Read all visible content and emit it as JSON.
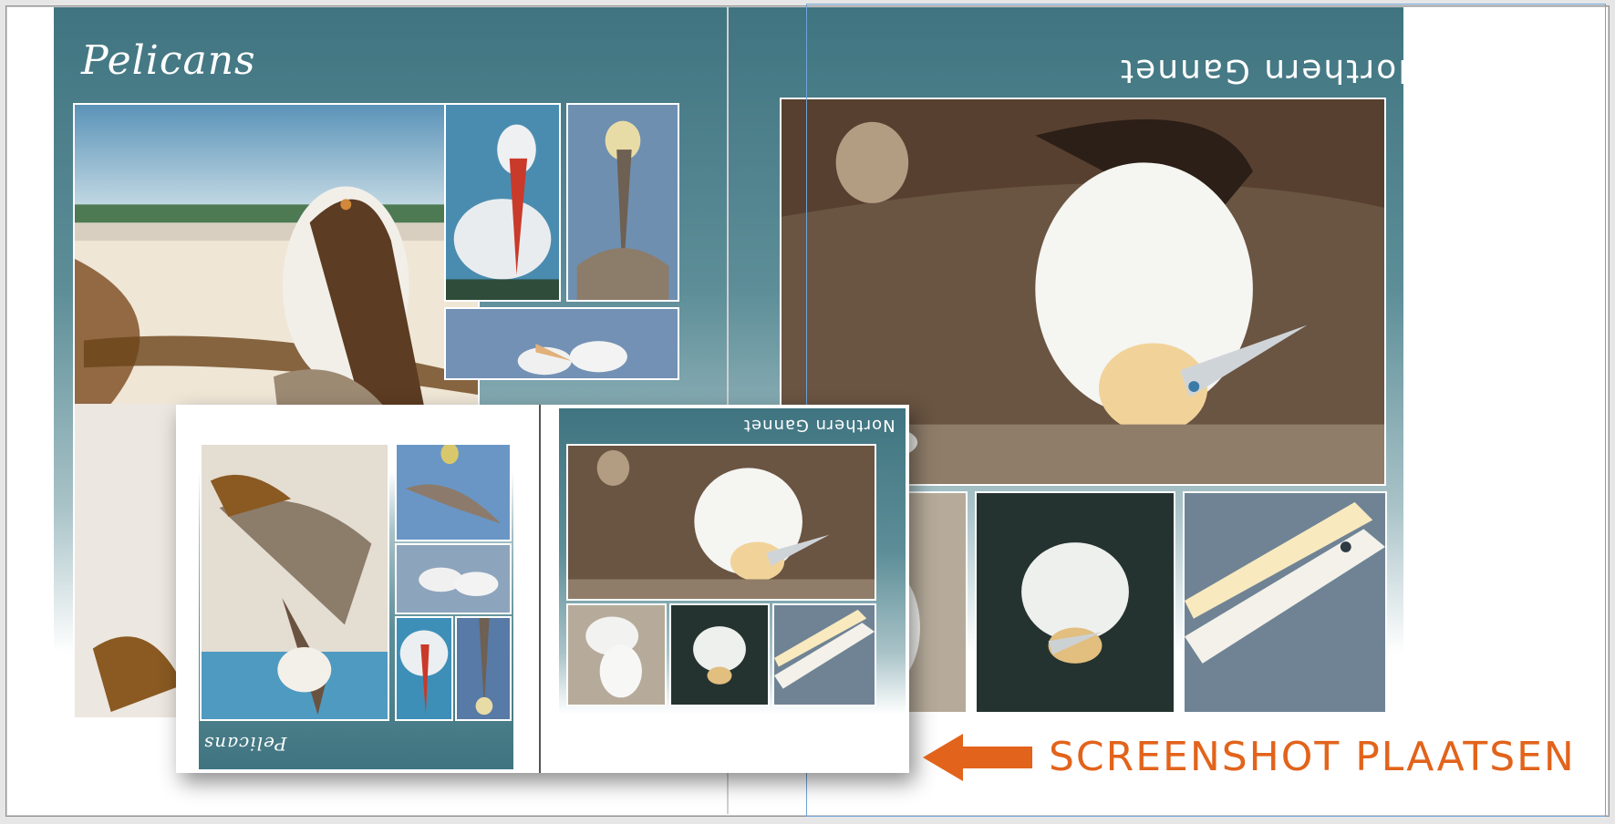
{
  "left_page": {
    "title": "Pelicans"
  },
  "right_page": {
    "title": "Northern Gannet"
  },
  "thumbnail": {
    "left_title": "Pelicans",
    "right_title": "Northern Gannet"
  },
  "callout": {
    "label": "SCREENSHOT  PLAATSEN",
    "arrow_color": "#e2631b"
  },
  "colors": {
    "panel": "#3f7480",
    "accent": "#e2631b",
    "selection": "#6fa4d9"
  }
}
